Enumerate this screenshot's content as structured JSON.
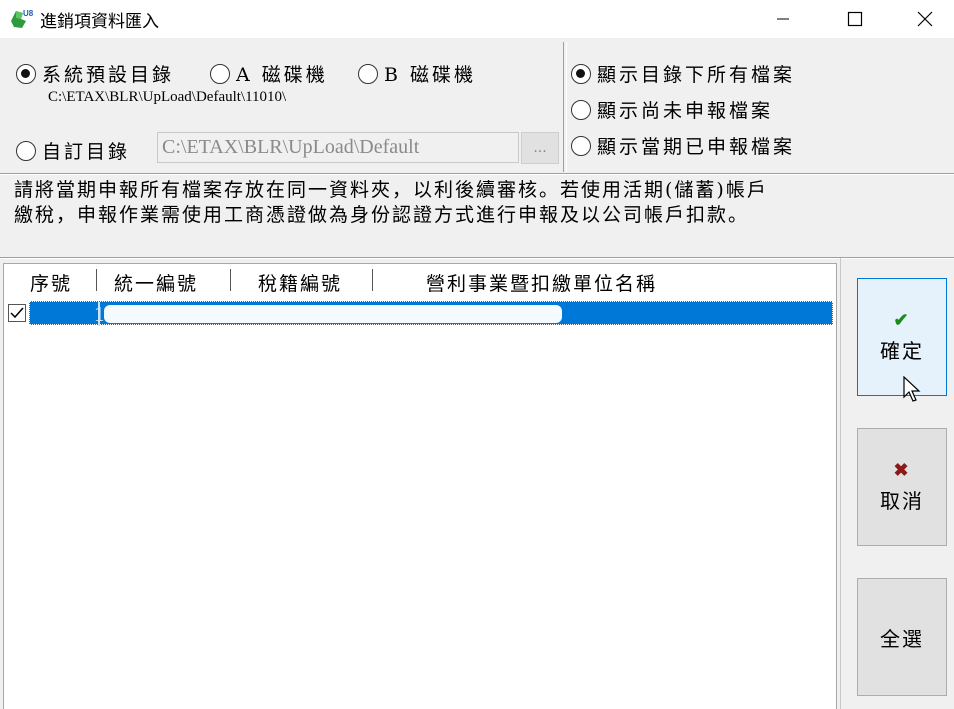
{
  "window": {
    "title": "進銷項資料匯入",
    "icon": "u8-app-icon",
    "controls": [
      "minimize-icon",
      "maximize-icon",
      "close-icon"
    ]
  },
  "directory_options": {
    "system_default": {
      "label": "系統預設目錄",
      "selected": true
    },
    "drive_a": {
      "label": "A 磁碟機",
      "selected": false
    },
    "drive_b": {
      "label": "B 磁碟機",
      "selected": false
    },
    "default_path": "C:\\ETAX\\BLR\\UpLoad\\Default\\11010\\",
    "custom": {
      "label": "自訂目錄",
      "selected": false
    },
    "custom_path_value": "C:\\ETAX\\BLR\\UpLoad\\Default",
    "browse_label": "..."
  },
  "file_filter": {
    "all": {
      "label": "顯示目錄下所有檔案",
      "selected": true
    },
    "unfiled": {
      "label": "顯示尚未申報檔案",
      "selected": false
    },
    "filed": {
      "label": "顯示當期已申報檔案",
      "selected": false
    }
  },
  "notice": {
    "line1": "請將當期申報所有檔案存放在同一資料夾，以利後續審核。若使用活期(儲蓄)帳戶",
    "line2": "繳稅，申報作業需使用工商憑證做為身份認證方式進行申報及以公司帳戶扣款。"
  },
  "table": {
    "columns": [
      "序號",
      "統一編號",
      "稅籍編號",
      "營利事業暨扣繳單位名稱"
    ],
    "rows": [
      {
        "checked": true,
        "index": "1"
      }
    ]
  },
  "buttons": {
    "confirm": "確定",
    "cancel": "取消",
    "select_all": "全選"
  },
  "colors": {
    "selection": "#0078d7",
    "confirm_check": "#1a8c1a",
    "cancel_x": "#8b1a1a"
  }
}
